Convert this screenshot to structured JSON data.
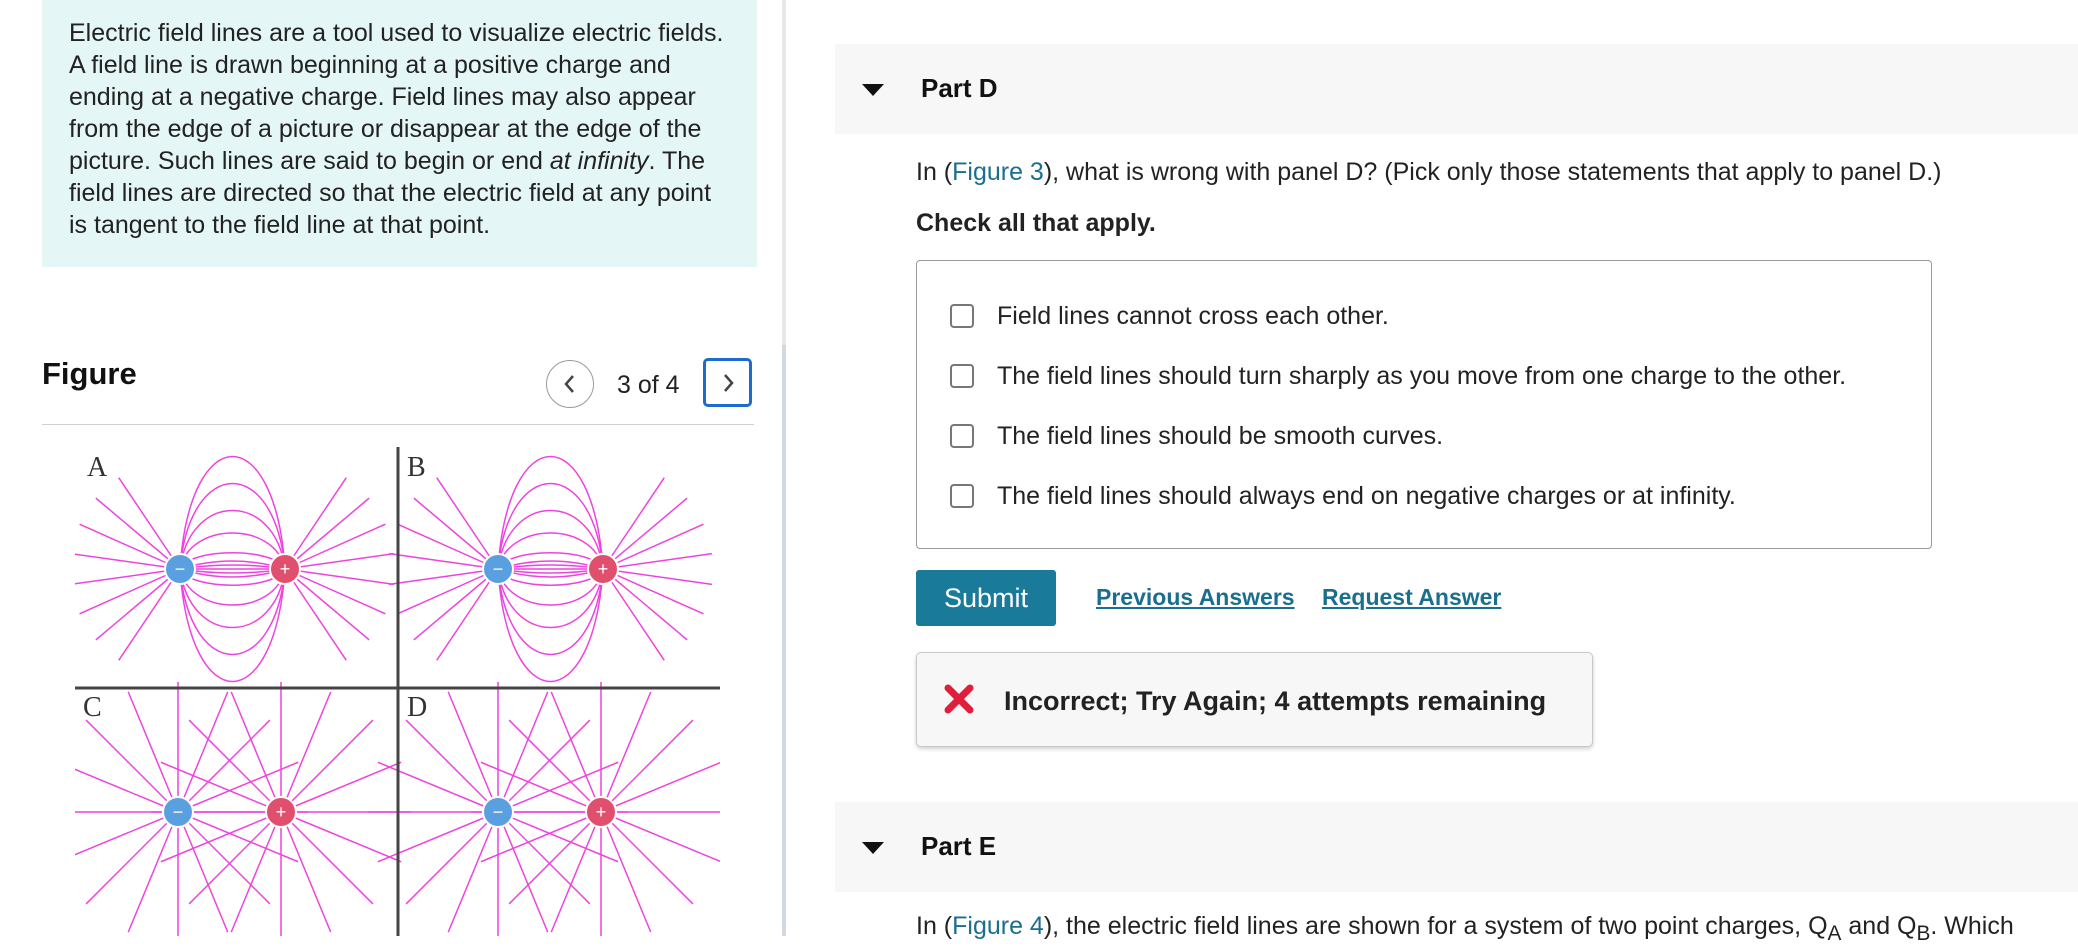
{
  "intro": {
    "text_before": "Electric field lines are a tool used to visualize electric fields. A field line is drawn beginning at a positive charge and ending at a negative charge. Field lines may also appear from the edge of a picture or disappear at the edge of the picture. Such lines are said to begin or end ",
    "emphasis": "at infinity",
    "text_after": ". The field lines are directed so that the electric field at any point is tangent to the field line at that point."
  },
  "figure": {
    "title": "Figure",
    "counter": "3 of 4",
    "prev_icon": "chevron-left-icon",
    "next_icon": "chevron-right-icon",
    "panel_labels": [
      "A",
      "B",
      "C",
      "D"
    ],
    "line_color": "#ee44dd",
    "negative_color": "#5aa0e0",
    "positive_color": "#e0506e"
  },
  "part_d": {
    "label": "Part D",
    "question_prefix": "In (",
    "question_link": "Figure 3",
    "question_suffix": "), what is wrong with panel D? (Pick only those statements that apply to panel D.)",
    "instruction": "Check all that apply.",
    "options": [
      "Field lines cannot cross each other.",
      "The field lines should turn sharply as you move from one charge to the other.",
      "The field lines should be smooth curves.",
      "The field lines should always end on negative charges or at infinity."
    ],
    "submit_label": "Submit",
    "previous_answers_label": "Previous Answers",
    "request_answer_label": "Request Answer",
    "feedback": "Incorrect; Try Again; 4 attempts remaining",
    "feedback_icon": "x-mark-icon"
  },
  "part_e": {
    "label": "Part E",
    "question_prefix": "In (",
    "question_link": "Figure 4",
    "question_suffix": "), the electric field lines are shown for a system of two point charges, Q",
    "sub_a": "A",
    "middle": " and Q",
    "sub_b": "B",
    "tail": ". Which"
  },
  "colors": {
    "accent": "#1a7a99",
    "link": "#1a6f8f",
    "intro_bg": "#e4f6f6",
    "error": "#e0203a"
  }
}
